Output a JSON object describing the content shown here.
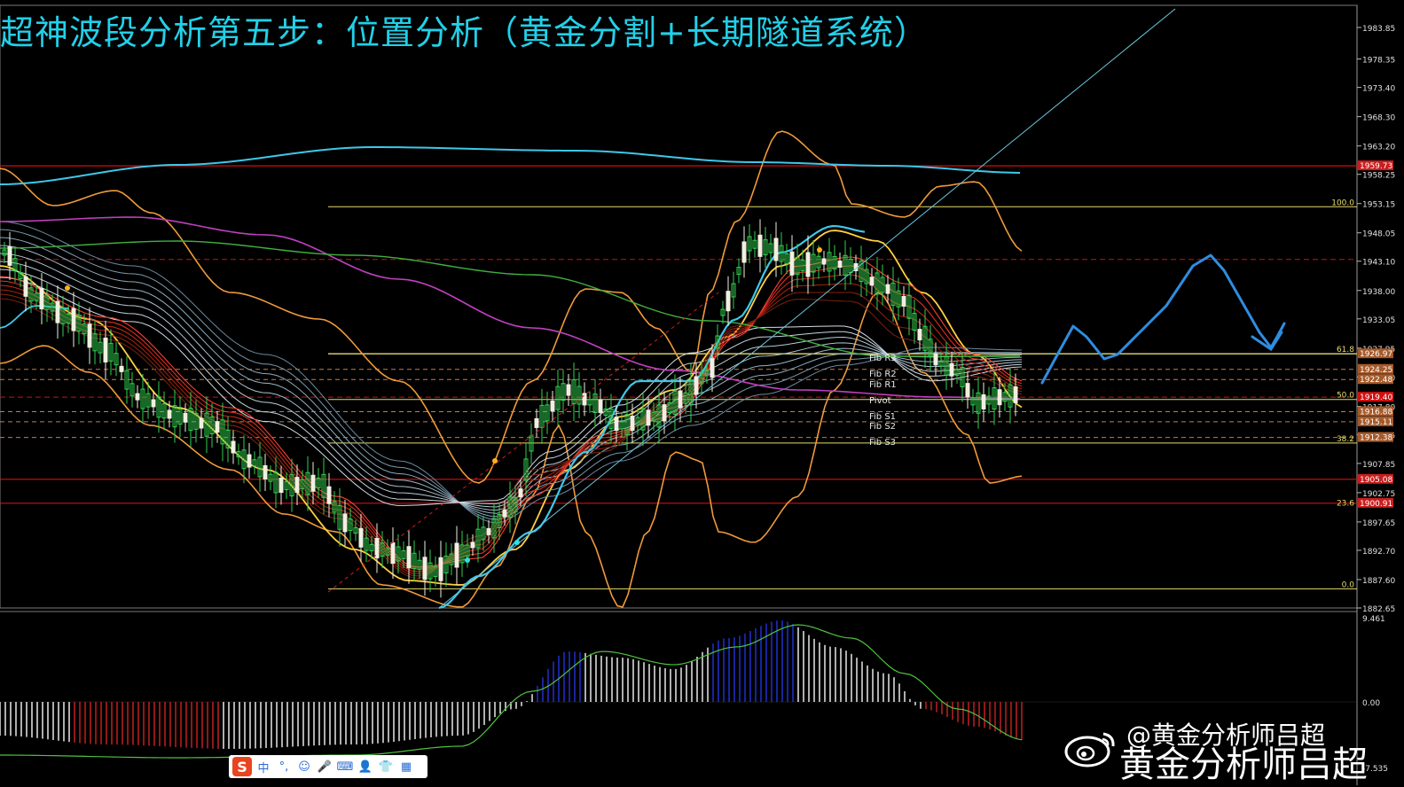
{
  "title": "超神波段分析第五步：位置分析（黄金分割+长期隧道系统）",
  "price_axis": {
    "ticks": [
      "1983.85",
      "1978.35",
      "1973.40",
      "1968.30",
      "1963.20",
      "1958.25",
      "1953.15",
      "1948.05",
      "1943.10",
      "1938.00",
      "1933.05",
      "1927.95",
      "1922.90",
      "1917.80",
      "1912.85",
      "1907.85",
      "1902.75",
      "1897.65",
      "1892.70",
      "1887.60",
      "1882.65"
    ]
  },
  "price_tags": [
    {
      "text": "1959.73",
      "color": "#c81e1e"
    },
    {
      "text": "1926.97",
      "color": "#a65a2a"
    },
    {
      "text": "1924.25",
      "color": "#a65a2a"
    },
    {
      "text": "1922.48",
      "color": "#a65a2a"
    },
    {
      "text": "1919.40",
      "color": "#d01010"
    },
    {
      "text": "1916.88",
      "color": "#a65a2a"
    },
    {
      "text": "1915.11",
      "color": "#a65a2a"
    },
    {
      "text": "1912.38",
      "color": "#a65a2a"
    },
    {
      "text": "1905.08",
      "color": "#c81e1e"
    },
    {
      "text": "1900.91",
      "color": "#c81e1e"
    }
  ],
  "fib_levels": [
    {
      "label": "100.0"
    },
    {
      "label": "61.8"
    },
    {
      "label": "50.0"
    },
    {
      "label": "38.2"
    },
    {
      "label": "23.6"
    },
    {
      "label": "0.0"
    }
  ],
  "pivot_labels": [
    "Fib R3",
    "Fib R2",
    "Fib R1",
    "Pivot",
    "Fib S1",
    "Fib S2",
    "Fib S3"
  ],
  "macd_axis": {
    "ticks": [
      "9.461",
      "0.00",
      "-7.535"
    ]
  },
  "ime_toolbar": {
    "logo": "S",
    "items": [
      "中",
      "°,",
      "☺",
      "🎤",
      "⌨",
      "👤",
      "👕",
      "▦"
    ]
  },
  "watermark": {
    "handle": "@黄金分析师吕超",
    "name": "黄金分析师吕超"
  },
  "colors": {
    "title": "#22d0e8",
    "background": "#000000",
    "fib": "#e6dc6e",
    "ma_cyan": "#3fc7ea",
    "bands": "#f09a3a",
    "forecast": "#2f8de0",
    "red_line": "#d01010"
  }
}
